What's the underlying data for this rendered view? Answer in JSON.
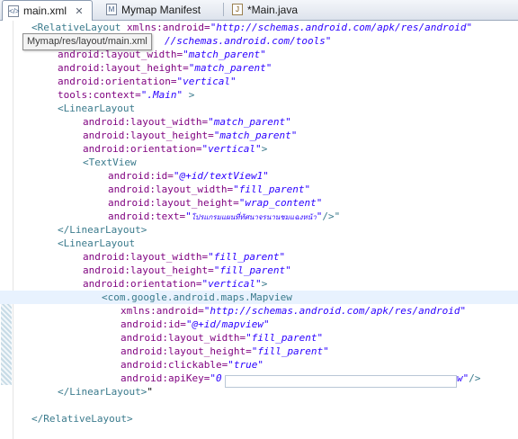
{
  "tabs": [
    {
      "label": "main.xml",
      "close": "✕",
      "icon": "android-xml-file-icon",
      "active": true
    },
    {
      "label": "Mymap Manifest",
      "icon": "android-manifest-file-icon",
      "active": false
    },
    {
      "label": "*Main.java",
      "icon": "java-file-icon",
      "active": false
    }
  ],
  "tooltip": "Mymap/res/layout/main.xml",
  "code": {
    "l1": {
      "open": "<RelativeLayout",
      "attr": " xmlns:android=",
      "val": "\"http://schemas.android.com/apk/res/android\""
    },
    "l2": {
      "val": "//schemas.android.com/tools\""
    },
    "l3": {
      "attr": "android:layout_width=",
      "val": "\"match_parent\""
    },
    "l4": {
      "attr": "android:layout_height=",
      "val": "\"match_parent\""
    },
    "l5": {
      "attr": "android:orientation=",
      "val": "\"vertical\""
    },
    "l6": {
      "attr": "tools:context=",
      "val": "\".Main\"",
      "close": " >"
    },
    "l7": {
      "tag": "<LinearLayout"
    },
    "l8": {
      "attr": "android:layout_width=",
      "val": "\"match_parent\""
    },
    "l9": {
      "attr": "android:layout_height=",
      "val": "\"match_parent\""
    },
    "l10": {
      "attr": "android:orientation=",
      "val": "\"vertical\"",
      "close": ">"
    },
    "l11": {
      "tag": "<TextView"
    },
    "l12": {
      "attr": "android:id=",
      "val": "\"@+id/textView1\""
    },
    "l13": {
      "attr": "android:layout_width=",
      "val": "\"fill_parent\""
    },
    "l14": {
      "attr": "android:layout_height=",
      "val": "\"wrap_content\""
    },
    "l15": {
      "attr": "android:text=",
      "q1": "\"",
      "thai": "โปรแกรมแผนที่ทัศนาจรนานชมแฉงหน้า",
      "q2": "\"",
      "close": "/>\""
    },
    "l16": {
      "tag": "</LinearLayout>"
    },
    "l17": {
      "tag": "<LinearLayout"
    },
    "l18": {
      "attr": "android:layout_width=",
      "val": "\"fill_parent\""
    },
    "l19": {
      "attr": "android:layout_height=",
      "val": "\"fill_parent\""
    },
    "l20": {
      "attr": "android:orientation=",
      "val": "\"vertical\"",
      "close": ">"
    },
    "l21": {
      "tag": "<com.google.android.maps.Mapview"
    },
    "l22": {
      "attr": "xmlns:android=",
      "val": "\"http://schemas.android.com/apk/res/android\""
    },
    "l23": {
      "attr": "android:id=",
      "val": "\"@+id/mapview\""
    },
    "l24": {
      "attr": "android:layout_width=",
      "val": "\"fill_parent\""
    },
    "l25": {
      "attr": "android:layout_height=",
      "val": "\"fill_parent\""
    },
    "l26": {
      "attr": "android:clickable=",
      "val": "\"true\""
    },
    "l27": {
      "attr": "android:apiKey=",
      "val": "\"0",
      "valEnd": "w\"",
      "close": "/>"
    },
    "l28": {
      "tag": "</LinearLayout>",
      "trail": "\""
    },
    "l30": {
      "tag": "</RelativeLayout>"
    }
  }
}
